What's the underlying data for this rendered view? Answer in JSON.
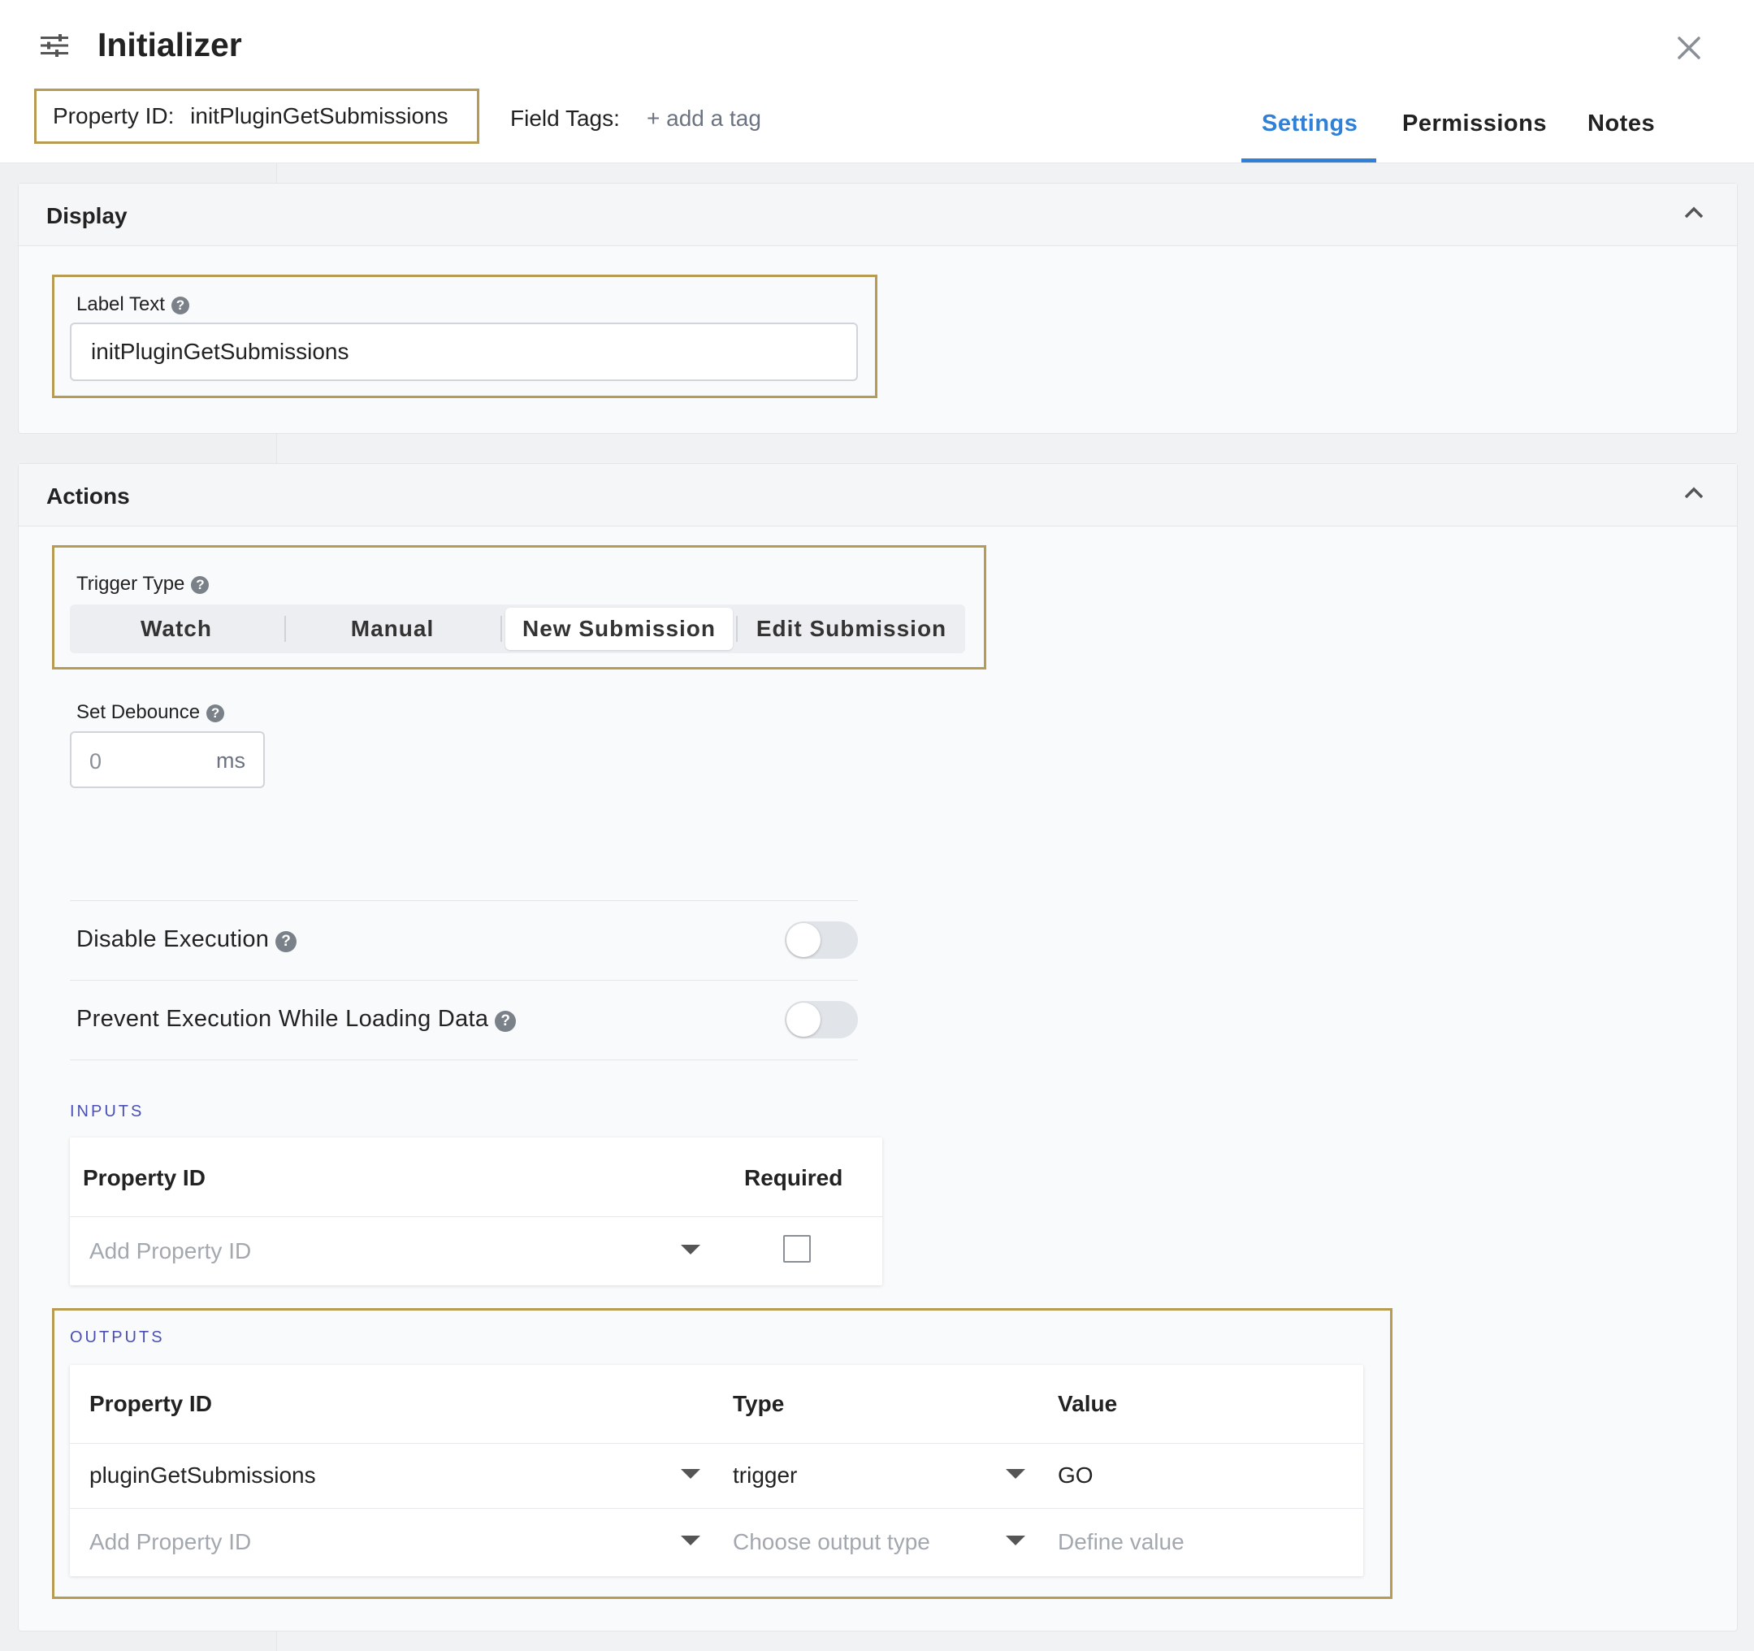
{
  "header": {
    "title": "Initializer",
    "property_id_label": "Property ID:",
    "property_id_value": "initPluginGetSubmissions",
    "field_tags_label": "Field Tags:",
    "add_tag": "+ add a tag",
    "tabs": [
      {
        "label": "Settings",
        "active": true
      },
      {
        "label": "Permissions",
        "active": false
      },
      {
        "label": "Notes",
        "active": false
      }
    ]
  },
  "display": {
    "title": "Display",
    "label_text_label": "Label Text",
    "label_text_value": "initPluginGetSubmissions"
  },
  "actions": {
    "title": "Actions",
    "trigger_type_label": "Trigger Type",
    "trigger_options": [
      "Watch",
      "Manual",
      "New Submission",
      "Edit Submission"
    ],
    "trigger_selected": "New Submission",
    "debounce_label": "Set Debounce",
    "debounce_value": "0",
    "debounce_unit": "ms",
    "disable_execution_label": "Disable Execution",
    "disable_execution_on": false,
    "prevent_execution_label": "Prevent Execution While Loading Data",
    "prevent_execution_on": false
  },
  "inputs": {
    "caption": "INPUTS",
    "col_property_id": "Property ID",
    "col_required": "Required",
    "add_placeholder": "Add Property ID",
    "required_checked": false
  },
  "outputs": {
    "caption": "OUTPUTS",
    "col_property_id": "Property ID",
    "col_type": "Type",
    "col_value": "Value",
    "rows": [
      {
        "property_id": "pluginGetSubmissions",
        "type": "trigger",
        "value": "GO"
      }
    ],
    "new_row": {
      "property_id_placeholder": "Add Property ID",
      "type_placeholder": "Choose output type",
      "value_placeholder": "Define value"
    }
  },
  "colors": {
    "accent": "#2f80d6",
    "highlight_border": "#b89b53",
    "caption": "#4a4fb5"
  }
}
